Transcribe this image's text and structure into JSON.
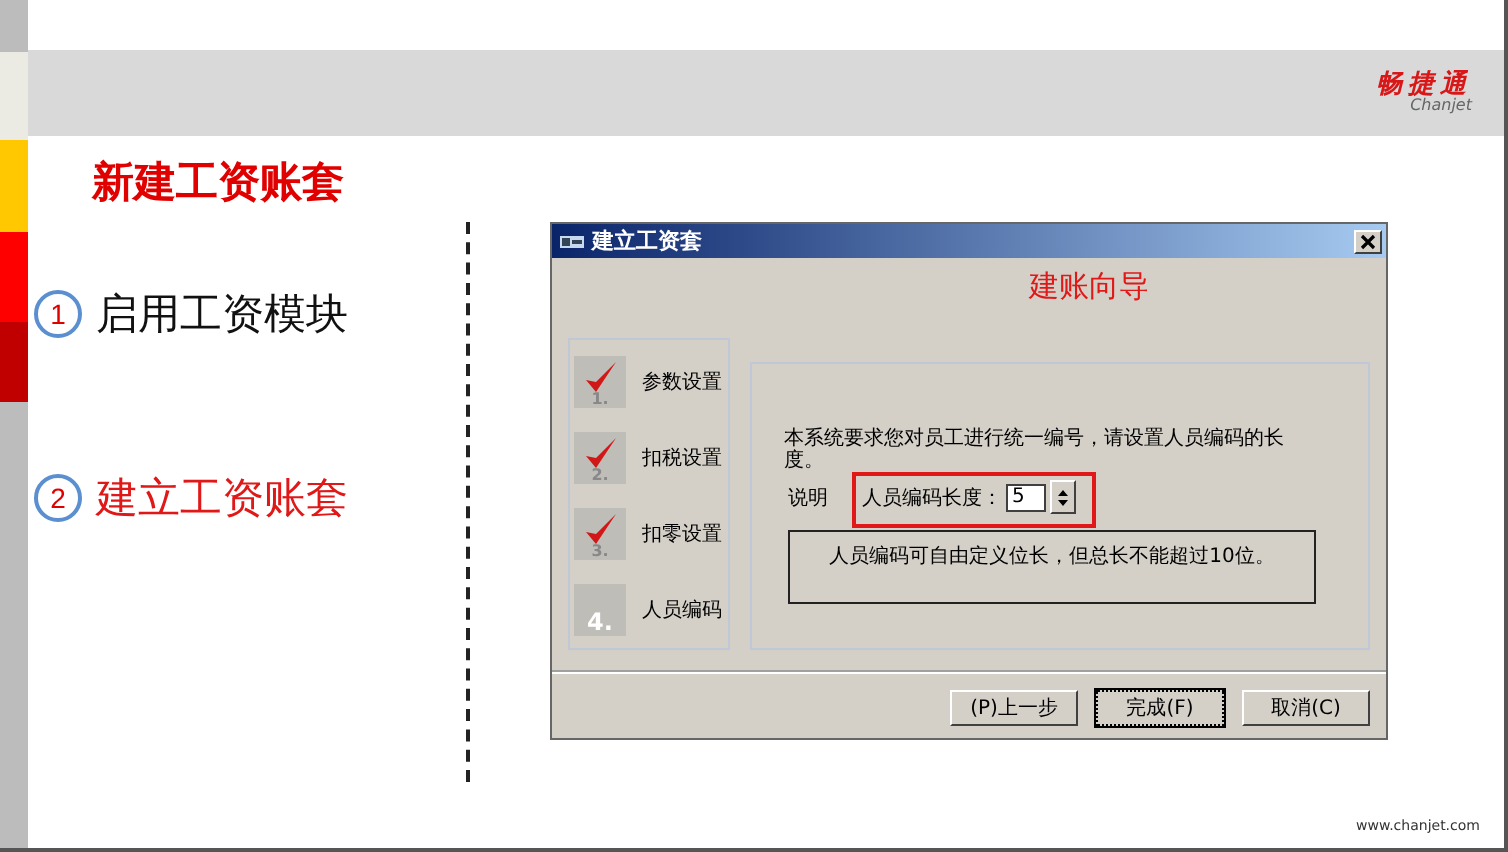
{
  "header": {
    "logo_text": "畅捷通",
    "logo_subtext": "Chanjet"
  },
  "slide_title": "新建工资账套",
  "steps": [
    {
      "number": "1",
      "label": "启用工资模块",
      "selected": false
    },
    {
      "number": "2",
      "label": "建立工资账套",
      "selected": true
    }
  ],
  "dialog": {
    "title": "建立工资套",
    "heading": "建账向导",
    "wizard_steps": [
      {
        "number": "1.",
        "label": "参数设置",
        "done": true
      },
      {
        "number": "2.",
        "label": "扣税设置",
        "done": true
      },
      {
        "number": "3.",
        "label": "扣零设置",
        "done": true
      },
      {
        "number": "4.",
        "label": "人员编码",
        "done": false
      }
    ],
    "instruction": "本系统要求您对员工进行统一编号，请设置人员编码的长度。",
    "section_label": "说明",
    "field": {
      "label": "人员编码长度：",
      "value": "5"
    },
    "note": "人员编码可自由定义位长，但总长不能超过10位。",
    "buttons": [
      {
        "label": "(P)上一步",
        "default": false
      },
      {
        "label": "完成(F)",
        "default": true
      },
      {
        "label": "取消(C)",
        "default": false
      }
    ]
  },
  "footer": "www.chanjet.com"
}
